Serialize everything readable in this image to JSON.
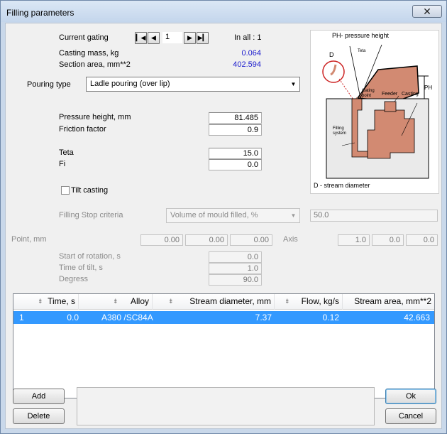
{
  "window": {
    "title": "Filling parameters",
    "close_glyph": "✕"
  },
  "gating": {
    "current_label": "Current gating",
    "current_value": "1",
    "in_all_label": "In all : 1",
    "first_icon": "first-icon",
    "prev_icon": "prev-icon",
    "next_icon": "next-icon",
    "last_icon": "last-icon"
  },
  "casting": {
    "mass_label": "Casting mass, kg",
    "mass_value": "0.064",
    "section_label": "Section area, mm**2",
    "section_value": "402.594"
  },
  "pouring": {
    "label": "Pouring type",
    "selected": "Ladle pouring (over lip)"
  },
  "params": {
    "pressure_label": "Pressure height, mm",
    "pressure_value": "81.485",
    "friction_label": "Friction factor",
    "friction_value": "0.9",
    "teta_label": "Teta",
    "teta_value": "15.0",
    "fi_label": "Fi",
    "fi_value": "0.0"
  },
  "tilt": {
    "label": "Tilt casting",
    "checked": false
  },
  "stop": {
    "label": "Filling Stop criteria",
    "selected": "Volume of mould filled, %",
    "value": "50.0"
  },
  "point": {
    "label": "Point, mm",
    "values": [
      "0.00",
      "0.00",
      "0.00"
    ],
    "axis_label": "Axis",
    "axis_values": [
      "1.0",
      "0.0",
      "0.0"
    ]
  },
  "rotation": {
    "start_label": "Start of rotation, s",
    "start_value": "0.0",
    "time_label": "Time of tilt, s",
    "time_value": "1.0",
    "degrees_label": "Degress",
    "degrees_value": "90.0"
  },
  "diagram": {
    "ph_caption": "PH- pressure height",
    "d_label": "D",
    "teta_label": "Teta",
    "ph_label": "PH",
    "gating_label": "Gating point",
    "feeder_label": "Feeder",
    "casting_label": "Casting",
    "filling_label": "Filling system",
    "d_caption": "D - stream diameter"
  },
  "table": {
    "columns": [
      "Time, s",
      "Alloy",
      "Stream diameter, mm",
      "Flow, kg/s",
      "Stream area, mm**2"
    ],
    "rows": [
      {
        "index": "1",
        "time": "0.0",
        "alloy": "A380 /SC84A",
        "diameter": "7.37",
        "flow": "0.12",
        "area": "42.663"
      }
    ]
  },
  "buttons": {
    "add": "Add",
    "delete": "Delete",
    "ok": "Ok",
    "cancel": "Cancel"
  },
  "colors": {
    "selection": "#3399ff",
    "accent_blue": "#1a1acd",
    "metal": "#d28a72"
  }
}
